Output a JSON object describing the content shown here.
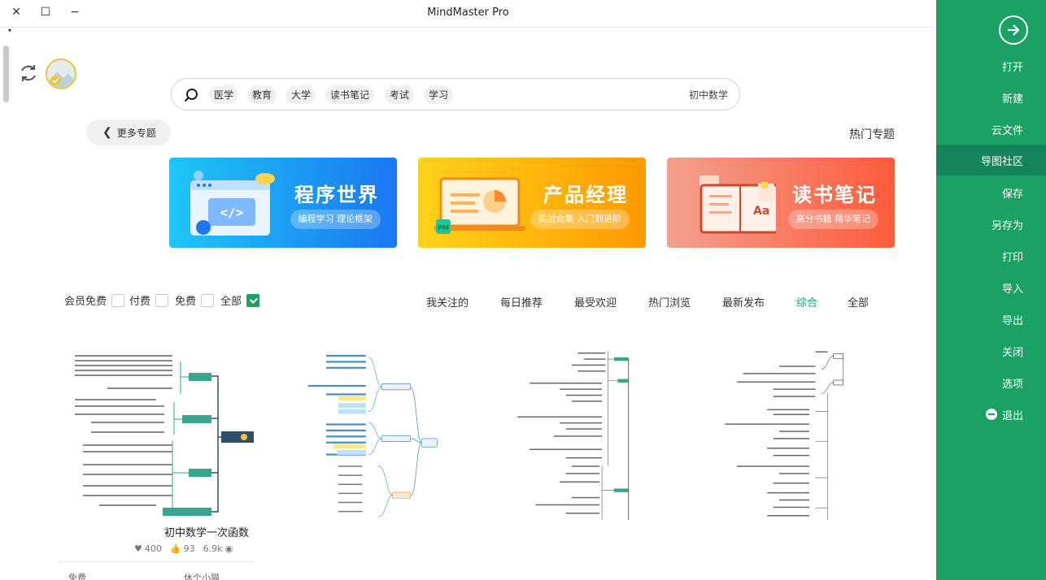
{
  "window": {
    "title": "MindMaster Pro",
    "close_glyph": "✕",
    "maximize_glyph": "☐",
    "minimize_glyph": "−",
    "menu_glyph": "▾"
  },
  "sidebar": {
    "back_icon": "arrow-right-circle-icon",
    "items": [
      {
        "label": "打开"
      },
      {
        "label": "新建"
      },
      {
        "label": "云文件"
      },
      {
        "label": "导图社区",
        "active": true
      },
      {
        "label": "保存"
      },
      {
        "label": "另存为"
      },
      {
        "label": "打印"
      },
      {
        "label": "导入"
      },
      {
        "label": "导出"
      },
      {
        "label": "关闭"
      },
      {
        "label": "选项"
      },
      {
        "label": "退出",
        "icon": "exit-icon"
      }
    ]
  },
  "search": {
    "placeholder": "初中数学",
    "tags": [
      "学习",
      "考试",
      "读书笔记",
      "大学",
      "教育",
      "医学"
    ]
  },
  "topics": {
    "more_label": "更多专题",
    "hot_label": "热门专题"
  },
  "banners": [
    {
      "title": "读书笔记",
      "subtitle": "高分书籍 精华笔记",
      "color_from": "#f3a08f",
      "color_to": "#fd5b3a"
    },
    {
      "title": "产品经理",
      "subtitle": "实战合集 入门到进阶",
      "color_from": "#ffd11a",
      "color_to": "#ff9a00"
    },
    {
      "title": "程序世界",
      "subtitle": "编程学习 理论框架",
      "color_from": "#1ec6f5",
      "color_to": "#1a78f2"
    }
  ],
  "filters": {
    "options": [
      {
        "label": "全部",
        "checked": true
      },
      {
        "label": "免费",
        "checked": false
      },
      {
        "label": "付费",
        "checked": false
      },
      {
        "label": "会员免费",
        "checked": false
      }
    ],
    "sort_tabs": [
      {
        "label": "全部"
      },
      {
        "label": "综合",
        "active": true
      },
      {
        "label": "最新发布"
      },
      {
        "label": "热门浏览"
      },
      {
        "label": "最受欢迎"
      },
      {
        "label": "每日推荐"
      },
      {
        "label": "我关注的"
      }
    ]
  },
  "first_card": {
    "title": "初中数学一次函数",
    "views": "6.9k",
    "likes": "93",
    "favorites": "400",
    "author": "休个小猫",
    "price": "免费"
  }
}
